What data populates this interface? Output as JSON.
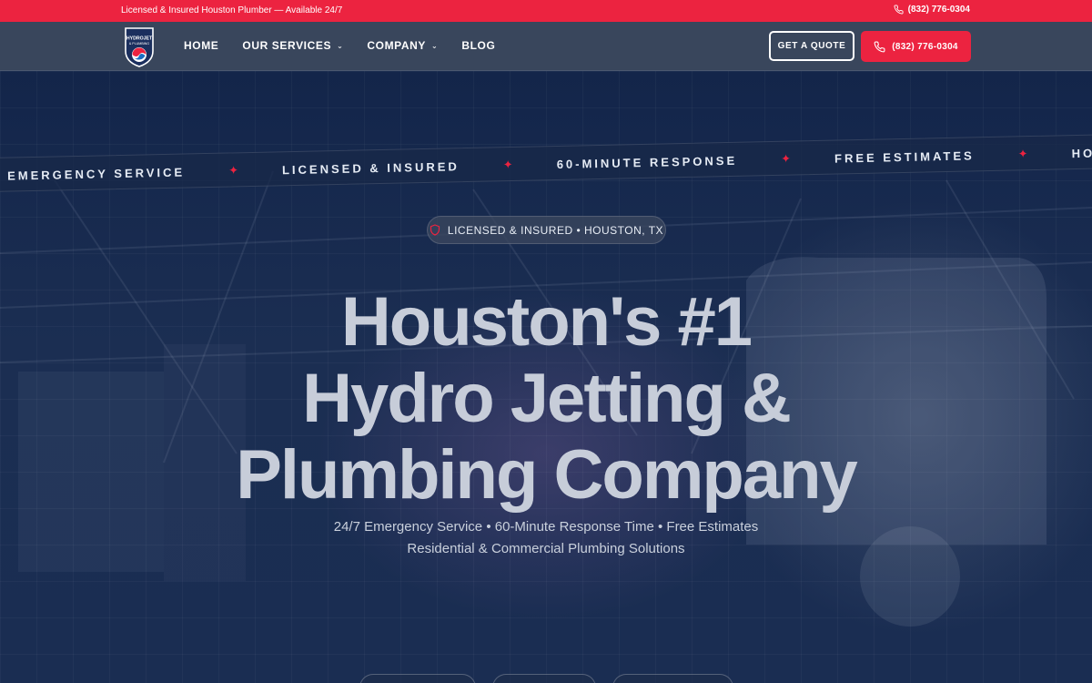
{
  "topbar": {
    "tagline": "Licensed & Insured Houston Plumber — Available 24/7",
    "phone": "(832) 776-0304"
  },
  "nav": {
    "logo_text": "HYDROJET & PLUMBING",
    "links": [
      {
        "label": "HOME",
        "dropdown": false
      },
      {
        "label": "OUR SERVICES",
        "dropdown": true
      },
      {
        "label": "COMPANY",
        "dropdown": true
      },
      {
        "label": "BLOG",
        "dropdown": false
      }
    ],
    "quote_button": "GET A QUOTE",
    "call_button": "(832) 776-0304"
  },
  "hero": {
    "ticker": [
      "EMERGENCY SERVICE",
      "LICENSED & INSURED",
      "60-MINUTE RESPONSE",
      "FREE ESTIMATES",
      "HOUSTON'S"
    ],
    "badge": "LICENSED & INSURED • HOUSTON, TX",
    "headline": [
      "Houston's #1",
      "Hydro Jetting &",
      "Plumbing Company"
    ],
    "subline1": "24/7 Emergency Service • 60-Minute Response Time • Free Estimates",
    "subline2": "Residential & Commercial Plumbing Solutions"
  },
  "colors": {
    "accent": "#ec2340",
    "nav_bg": "#39465c",
    "hero_bg": "#13254a",
    "headline": "#c7cdd9"
  },
  "icons": [
    "phone-icon",
    "shield-icon",
    "chevron-down-icon",
    "star-icon"
  ]
}
